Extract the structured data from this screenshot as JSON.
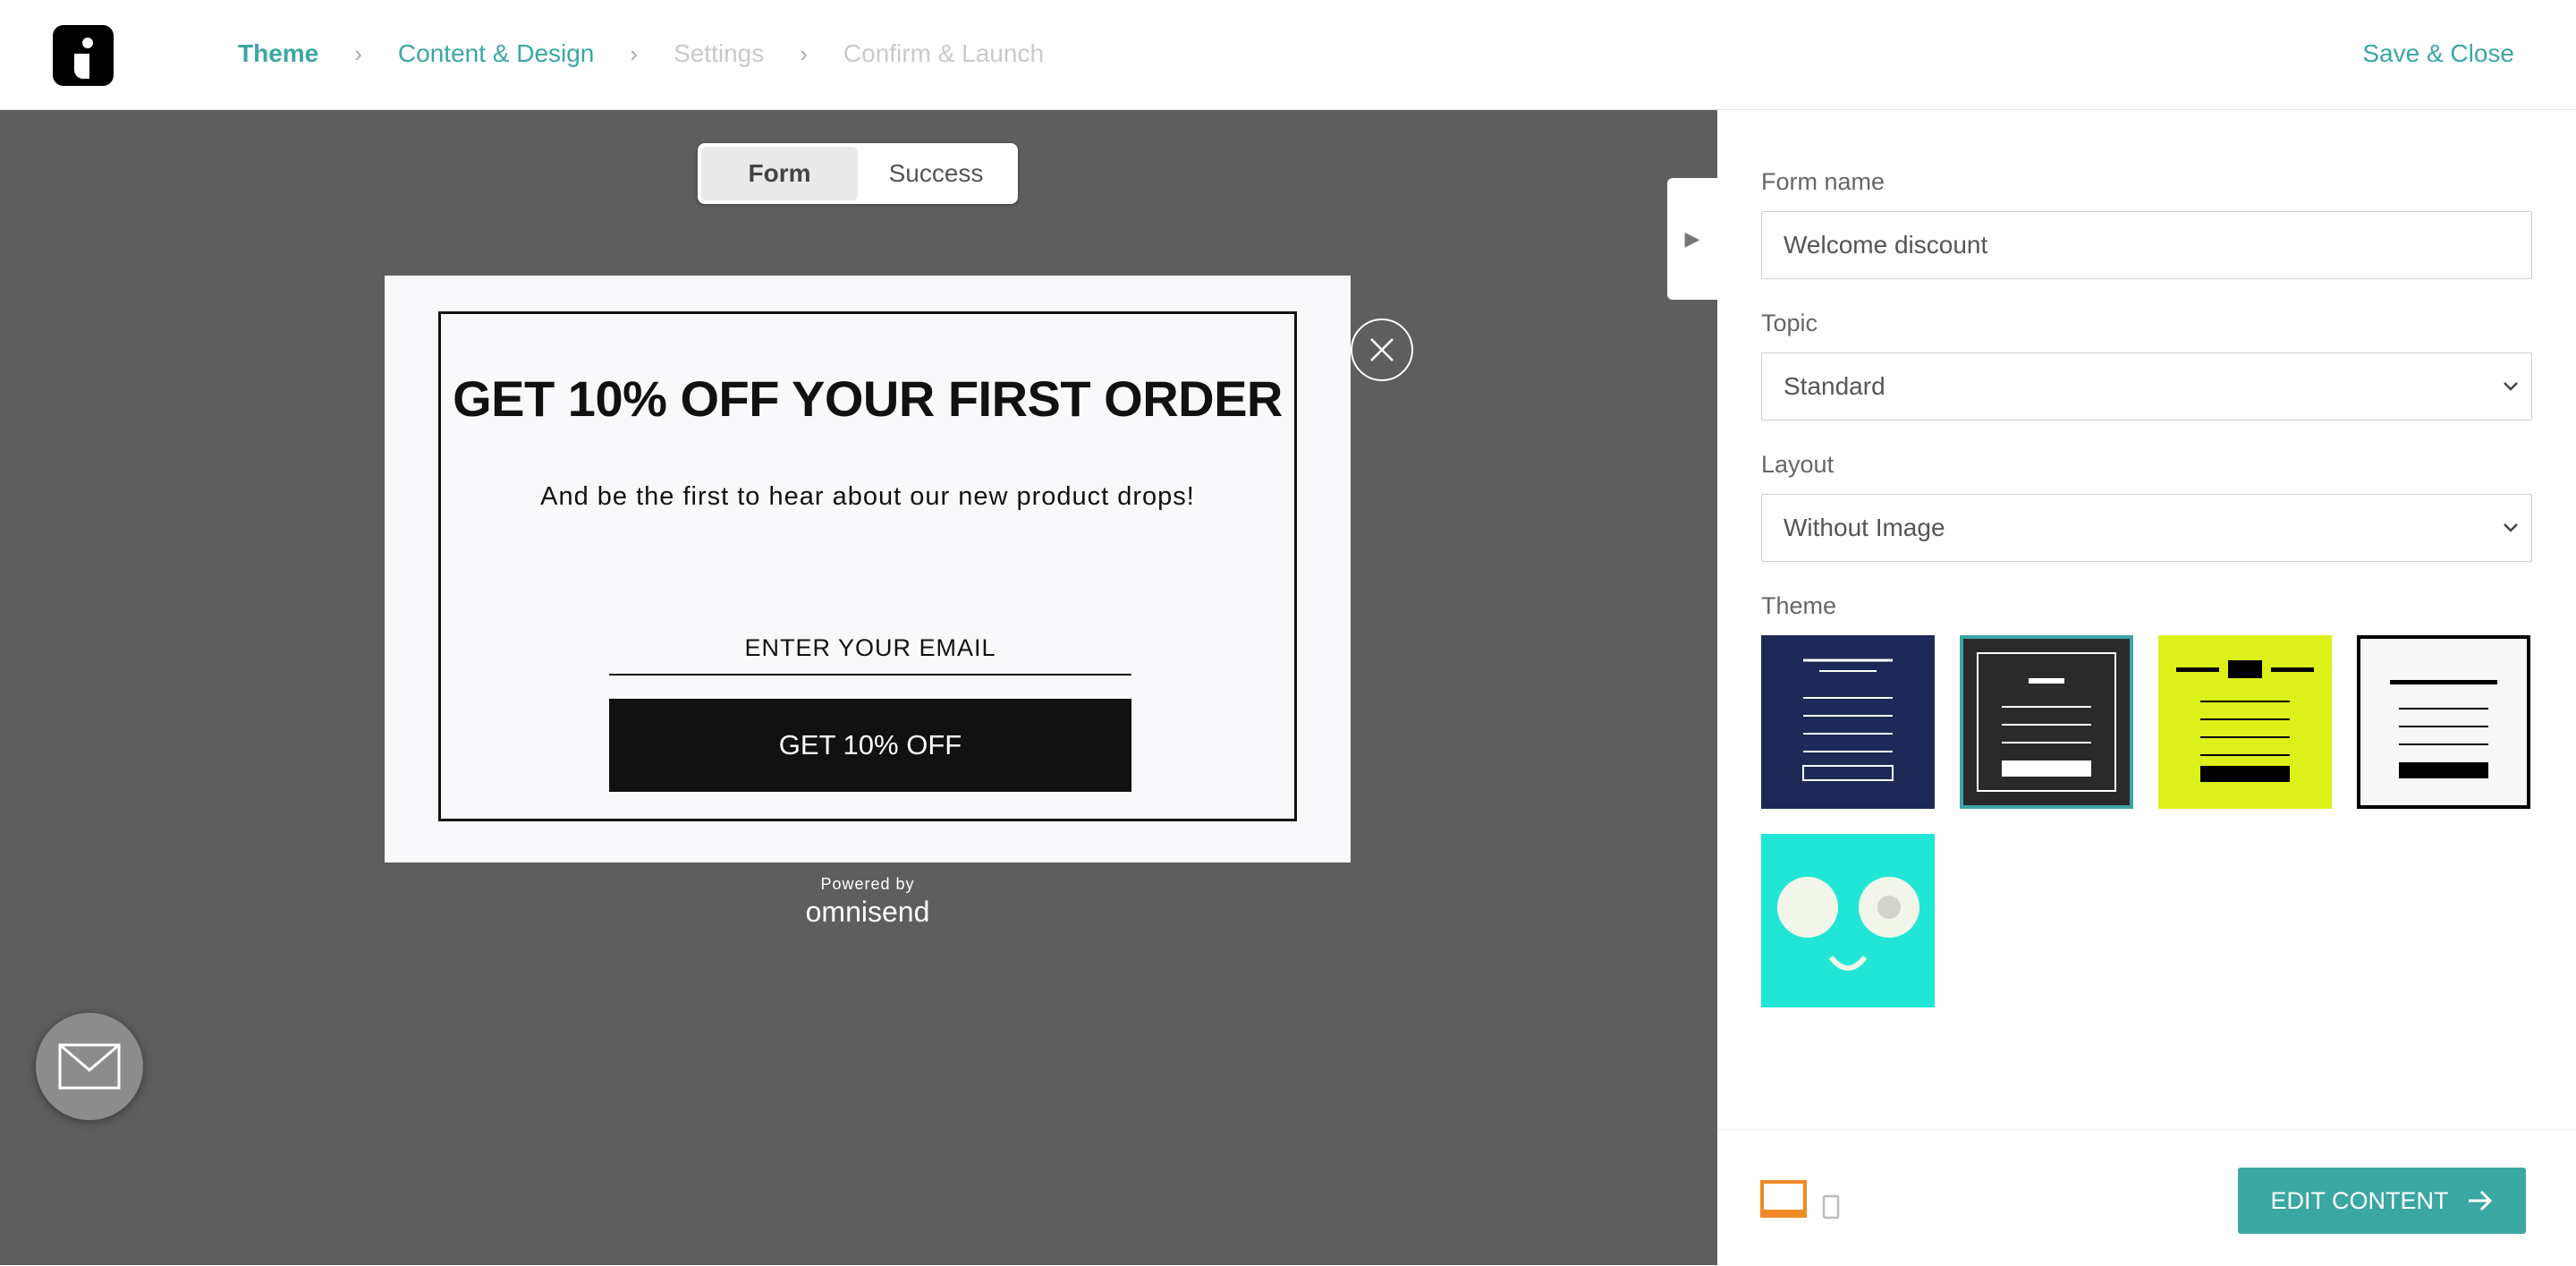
{
  "header": {
    "steps": [
      {
        "label": "Theme"
      },
      {
        "label": "Content & Design"
      },
      {
        "label": "Settings"
      },
      {
        "label": "Confirm & Launch"
      }
    ],
    "save_close": "Save & Close"
  },
  "canvas": {
    "toggle": {
      "form": "Form",
      "success": "Success"
    },
    "popup": {
      "title": "GET 10% OFF YOUR FIRST ORDER",
      "subtitle": "And be the first to hear about our new product drops!",
      "email_placeholder": "ENTER YOUR EMAIL",
      "cta": "GET 10% OFF"
    },
    "powered_by": "Powered by",
    "brand": "omnisend"
  },
  "panel": {
    "form_name_label": "Form name",
    "form_name_value": "Welcome discount",
    "topic_label": "Topic",
    "topic_value": "Standard",
    "layout_label": "Layout",
    "layout_value": "Without Image",
    "theme_label": "Theme",
    "themes": [
      {
        "name": "navy",
        "color": "#1d2a57",
        "selected": false
      },
      {
        "name": "dark",
        "color": "#2a2a2a",
        "selected": true
      },
      {
        "name": "lime",
        "color": "#dcf01a",
        "selected": false
      },
      {
        "name": "white",
        "color": "#f7f7f7",
        "selected": false
      },
      {
        "name": "face",
        "color": "#22e6d5",
        "selected": false
      }
    ],
    "edit_button": "EDIT CONTENT"
  },
  "colors": {
    "accent": "#3ba7a3",
    "canvas": "#5e5e5e",
    "desktop_icon": "#f08a24"
  }
}
